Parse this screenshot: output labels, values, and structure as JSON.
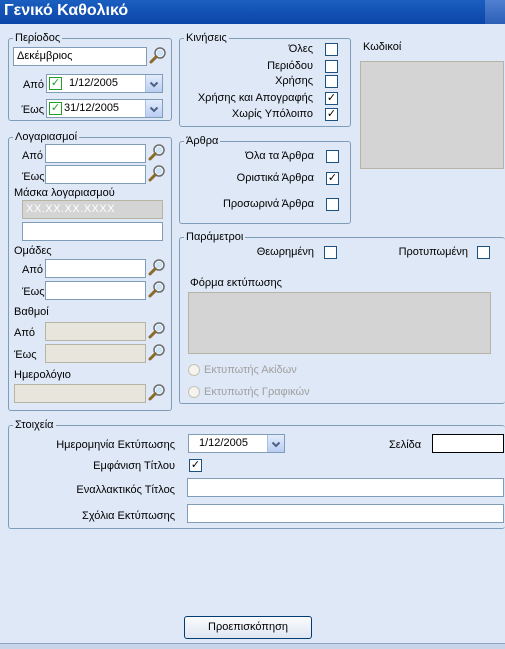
{
  "window": {
    "title": "Γενικό Καθολικό"
  },
  "period": {
    "legend": "Περίοδος",
    "value": "Δεκέμβριος",
    "from_label": "Από",
    "from_value": "1/12/2005",
    "to_label": "Έως",
    "to_value": "31/12/2005"
  },
  "accounts": {
    "legend": "Λογαριασμοί",
    "from_label": "Από",
    "to_label": "Έως",
    "mask_label": "Μάσκα λογαριασμού",
    "mask_value": "XX.XX.XX.XXXX",
    "groups_label": "Ομάδες",
    "groups_from_label": "Από",
    "groups_to_label": "Έως",
    "degrees_label": "Βαθμοί",
    "degrees_from_label": "Από",
    "degrees_to_label": "Έως",
    "journal_label": "Ημερολόγιο"
  },
  "movements": {
    "legend": "Κινήσεις",
    "options": [
      {
        "label": "Όλες",
        "checked": false
      },
      {
        "label": "Περιόδου",
        "checked": false
      },
      {
        "label": "Χρήσης",
        "checked": false
      },
      {
        "label": "Χρήσης και Απογραφής",
        "checked": true
      },
      {
        "label": "Χωρίς Υπόλοιπο",
        "checked": true
      }
    ],
    "codes_label": "Κωδικοί"
  },
  "articles": {
    "legend": "Άρθρα",
    "options": [
      {
        "label": "Όλα τα Άρθρα",
        "checked": false
      },
      {
        "label": "Οριστικά Άρθρα",
        "checked": true
      },
      {
        "label": "Προσωρινά Άρθρα",
        "checked": false
      }
    ]
  },
  "parameters": {
    "legend": "Παράμετροι",
    "approved_label": "Θεωρημένη",
    "preprinted_label": "Προτυπωμένη",
    "print_form_label": "Φόρμα εκτύπωσης",
    "printer_needle_label": "Εκτυπωτής Ακίδων",
    "printer_graphics_label": "Εκτυπωτής Γραφικών"
  },
  "details": {
    "legend": "Στοιχεία",
    "print_date_label": "Ημερομηνία Εκτύπωσης",
    "print_date_value": "1/12/2005",
    "page_label": "Σελίδα",
    "show_title_label": "Εμφάνιση Τίτλου",
    "show_title_checked": true,
    "alt_title_label": "Εναλλακτικός Τίτλος",
    "print_comments_label": "Σχόλια Εκτύπωσης"
  },
  "preview_button": "Προεπισκόπηση",
  "icons": {
    "search": "magnifier-icon",
    "dropdown": "chevron-down-icon",
    "check": "check-icon"
  },
  "colors": {
    "titlebar": "#0b45a8",
    "background": "#dfe8f6",
    "border": "#7f9db9",
    "check_green": "#21a121"
  }
}
